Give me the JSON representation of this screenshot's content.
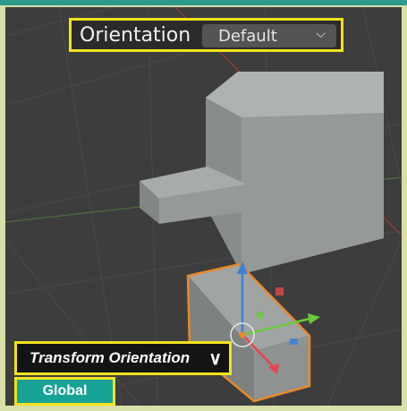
{
  "header": {
    "orientation_label": "Orientation",
    "orientation_value": "Default",
    "dropdown_icon": "chevron-down-icon"
  },
  "callout": {
    "transform_orientation_label": "Transform Orientation",
    "expand_icon": "chevron-down-icon",
    "global_label": "Global"
  },
  "colors": {
    "highlight_border": "#f2e21c",
    "global_badge": "#17a296",
    "frame_accent": "#2e9a8c",
    "selection_outline": "#e8892b",
    "axis_x": "#e8434f",
    "axis_y": "#6bc93b",
    "axis_z": "#3d7fd9"
  }
}
